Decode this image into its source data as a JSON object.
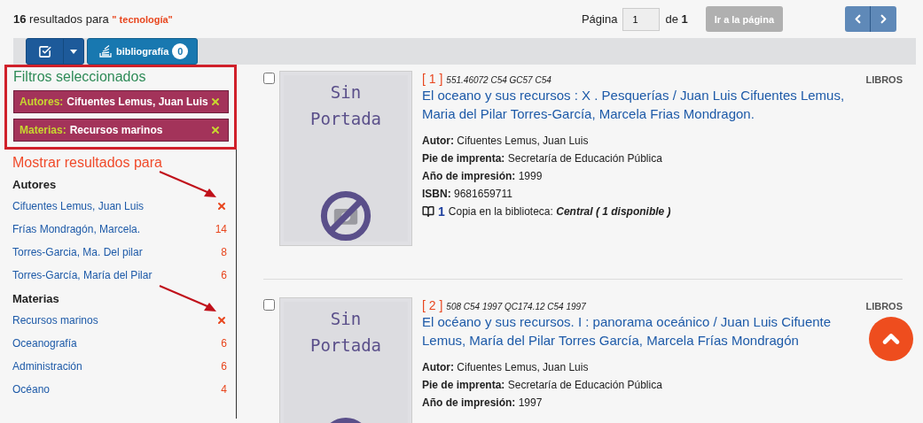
{
  "summary": {
    "count": "16",
    "text": "resultados para",
    "query": "\" tecnología\""
  },
  "pagination": {
    "label": "Página",
    "value": "1",
    "of": "de",
    "total": "1",
    "go_button": {
      "label": "Ir a la página",
      "disabled": true
    }
  },
  "toolbar": {
    "bibliography": {
      "label": "bibliografía",
      "badge": "0"
    }
  },
  "selected_filters": {
    "title": "Filtros seleccionados",
    "chips": [
      {
        "label": "Autores:",
        "value": "Cifuentes Lemus, Juan Luis"
      },
      {
        "label": "Materias:",
        "value": "Recursos marinos"
      }
    ]
  },
  "facets": {
    "title": "Mostrar resultados para",
    "groups": [
      {
        "heading": "Autores",
        "items": [
          {
            "label": "Cifuentes Lemus, Juan Luis",
            "selected": true
          },
          {
            "label": "Frías Mondragón, Marcela.",
            "count": "14",
            "selected": false
          },
          {
            "label": "Torres-Garcia, Ma. Del pilar",
            "count": "8",
            "selected": false
          },
          {
            "label": "Torres-García, María del Pilar",
            "count": "6",
            "selected": false
          }
        ]
      },
      {
        "heading": "Materias",
        "items": [
          {
            "label": "Recursos marinos",
            "selected": true
          },
          {
            "label": "Oceanografía",
            "count": "6",
            "selected": false
          },
          {
            "label": "Administración",
            "count": "6",
            "selected": false
          },
          {
            "label": "Océano",
            "count": "4",
            "selected": false
          }
        ]
      }
    ]
  },
  "results": [
    {
      "checked": false,
      "cover": [
        "Sin",
        "Portada"
      ],
      "number": "[ 1 ]",
      "call_number": "551.46072 C54 GC57 C54",
      "type": "LIBROS",
      "title_lines": [
        "El oceano y sus recursos : X . Pesquerías / Juan Luis Cifuentes Lemus,",
        "Maria del Pilar Torres-García, Marcela Frias Mondragon."
      ],
      "fields": [
        {
          "label": "Autor:",
          "value": "Cifuentes Lemus, Juan Luis"
        },
        {
          "label": "Pie de imprenta:",
          "value": "Secretaría de Educación Pública"
        },
        {
          "label": "Año de impresión:",
          "value": "1999"
        },
        {
          "label": "ISBN:",
          "value": "9681659711"
        }
      ],
      "copies": {
        "count": "1",
        "text": "Copia en la biblioteca:",
        "location": "Central ( 1 disponible )"
      }
    },
    {
      "checked": false,
      "cover": [
        "Sin",
        "Portada"
      ],
      "number": "[ 2 ]",
      "call_number": "508 C54 1997 QC174.12 C54 1997",
      "type": "LIBROS",
      "title_lines": [
        "El océano y sus recursos. I : panorama oceánico / Juan Luis Cifuente",
        "Lemus, María del Pilar Torres García, Marcela Frías Mondragón"
      ],
      "fields": [
        {
          "label": "Autor:",
          "value": "Cifuentes Lemus, Juan Luis"
        },
        {
          "label": "Pie de imprenta:",
          "value": "Secretaría de Educación Pública"
        },
        {
          "label": "Año de impresión:",
          "value": "1997"
        }
      ]
    }
  ]
}
